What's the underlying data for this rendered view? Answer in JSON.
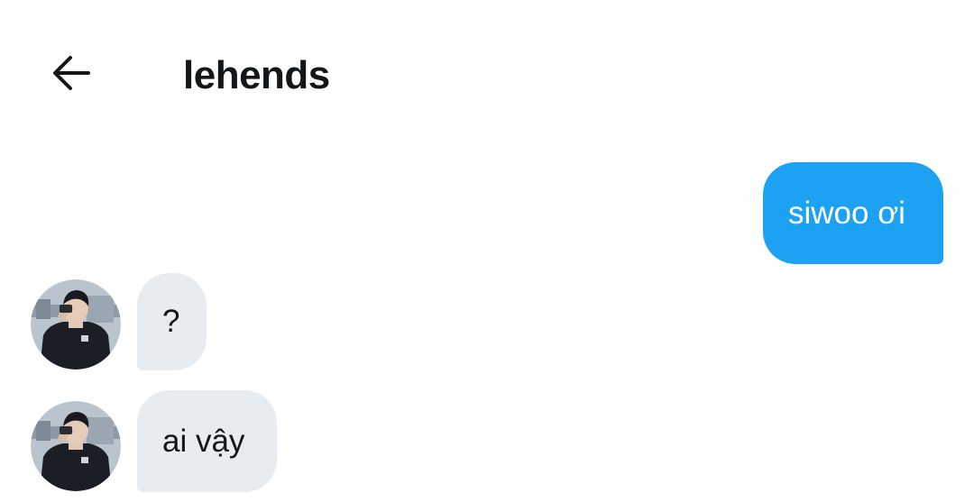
{
  "header": {
    "back_icon": "arrow-left-icon",
    "title": "lehends"
  },
  "messages": [
    {
      "direction": "sent",
      "text": "siwoo ơi",
      "color": "#1da1f2"
    },
    {
      "direction": "received",
      "text": "?",
      "color": "#e6ecf0"
    },
    {
      "direction": "received",
      "text": "ai vậy",
      "color": "#e6ecf0"
    }
  ],
  "colors": {
    "accent": "#1da1f2",
    "received_bubble": "#e6ecf0",
    "text_primary": "#14171a"
  }
}
